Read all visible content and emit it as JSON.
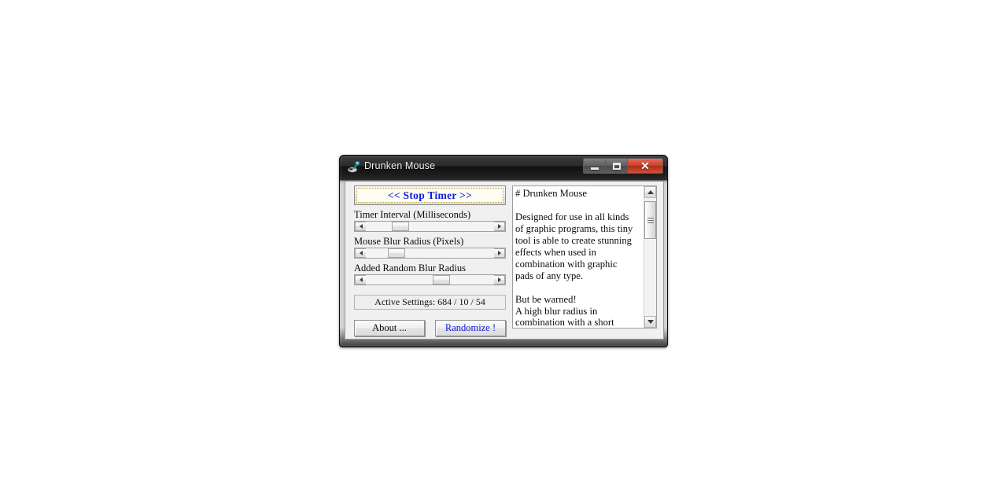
{
  "window": {
    "title": "Drunken Mouse",
    "icon": "mouse-device-icon",
    "controls": {
      "minimize": "Minimize",
      "maximize": "Maximize",
      "close": "Close",
      "close_glyph": "✕"
    }
  },
  "main": {
    "stop_timer_button": "<<  Stop Timer  >>",
    "sliders": [
      {
        "label": "Timer Interval (Milliseconds)",
        "value": 684,
        "thumb_percent": 20
      },
      {
        "label": "Mouse Blur Radius (Pixels)",
        "value": 10,
        "thumb_percent": 17
      },
      {
        "label": "Added Random Blur Radius",
        "value": 54,
        "thumb_percent": 52
      }
    ],
    "active_settings": "Active Settings: 684 / 10 / 54",
    "buttons": {
      "about": "About ...",
      "randomize": "Randomize !"
    }
  },
  "info_panel": {
    "text": "# Drunken Mouse\n\nDesigned for use in all kinds of graphic programs, this tiny tool is able to create stunning effects when used in combination with graphic pads of any type.\n\nBut be warned!\nA high blur radius in combination with a short timer"
  },
  "colors": {
    "accent_link": "#0d1ad8",
    "titlebar_dark": "#1c1c1c",
    "close_red": "#c9412a",
    "client_bg": "#f0f0f0",
    "focus_dotted": "#b9a53a"
  }
}
